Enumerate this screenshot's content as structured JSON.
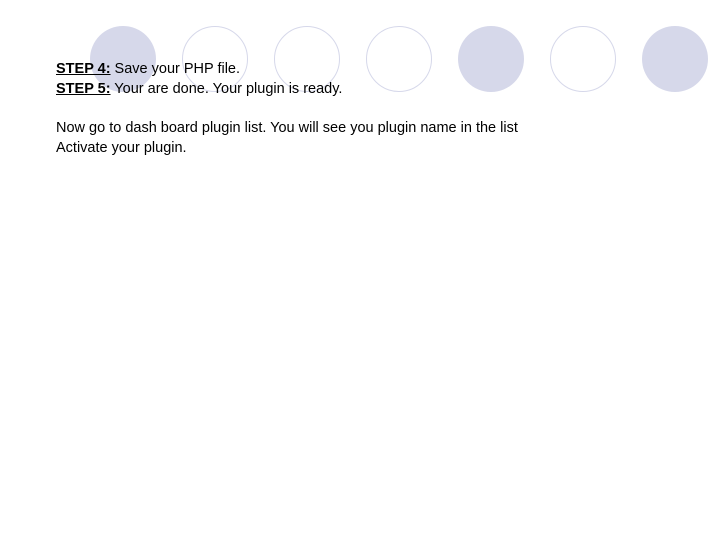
{
  "steps": [
    {
      "label": "STEP 4:",
      "text": " Save your PHP file."
    },
    {
      "label": "STEP 5:",
      "text": " Your are done. Your plugin is ready."
    }
  ],
  "body": [
    "Now go to dash board plugin list. You will see you plugin name in the list",
    "Activate your plugin."
  ]
}
